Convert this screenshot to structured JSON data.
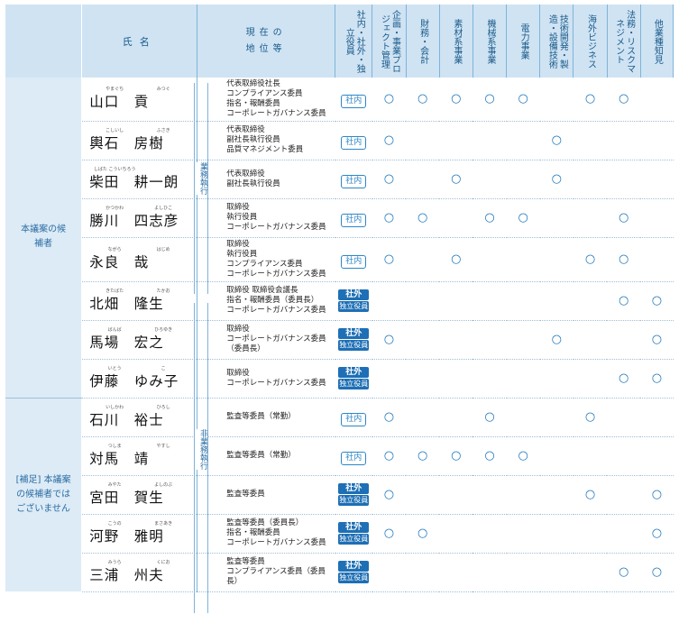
{
  "header": {
    "name": "氏名",
    "position_line1": "現在の",
    "position_line2": "地位等",
    "columns": [
      "社内・社外・独立役員",
      "企画・事業プロジェクト管理",
      "財務・会計",
      "素材系事業",
      "機械系事業",
      "電力事業",
      "技術開発・製造・設備技術",
      "海外ビジネス",
      "法務・リスクマネジメント",
      "他業種知見"
    ]
  },
  "categories": {
    "main": "本議案の候補者",
    "supplement": "[補足] 本議案の候補者ではございません"
  },
  "groups": {
    "executive": "業務執行",
    "non_executive": "非業務執行"
  },
  "badges": {
    "internal": "社内",
    "external": "社外",
    "independent": "独立役員"
  },
  "mark": "○",
  "rows": [
    {
      "ruby1": "やまぐち",
      "ruby2": "みつぐ",
      "name": "山口　貢",
      "positions": [
        "代表取締役社長",
        "コンプライアンス委員",
        "指名・報酬委員",
        "コーポレートガバナンス委員"
      ],
      "type": "internal",
      "marks": [
        1,
        1,
        1,
        1,
        1,
        0,
        1,
        1,
        0
      ]
    },
    {
      "ruby1": "こしいし",
      "ruby2": "ふさき",
      "name": "輿石　房樹",
      "positions": [
        "代表取締役",
        "副社長執行役員",
        "品質マネジメント委員"
      ],
      "type": "internal",
      "marks": [
        1,
        0,
        0,
        0,
        0,
        1,
        0,
        0,
        0
      ]
    },
    {
      "ruby1": "しばた こういちろう",
      "ruby2": "",
      "name": "柴田　耕一朗",
      "positions": [
        "代表取締役",
        "副社長執行役員"
      ],
      "type": "internal",
      "marks": [
        1,
        0,
        1,
        0,
        0,
        1,
        0,
        0,
        0
      ]
    },
    {
      "ruby1": "かつかわ",
      "ruby2": "よしひこ",
      "name": "勝川　四志彦",
      "positions": [
        "取締役",
        "執行役員",
        "コーポレートガバナンス委員"
      ],
      "type": "internal",
      "marks": [
        1,
        1,
        0,
        1,
        1,
        0,
        0,
        1,
        0
      ]
    },
    {
      "ruby1": "ながら",
      "ruby2": "はじめ",
      "name": "永良　哉",
      "positions": [
        "取締役",
        "執行役員",
        "コンプライアンス委員",
        "コーポレートガバナンス委員"
      ],
      "type": "internal",
      "marks": [
        1,
        0,
        1,
        0,
        0,
        0,
        1,
        1,
        0
      ]
    },
    {
      "ruby1": "きたばた",
      "ruby2": "たかお",
      "name": "北畑　隆生",
      "positions": [
        "取締役 取締役会議長",
        "指名・報酬委員（委員長）",
        "コーポレートガバナンス委員"
      ],
      "type": "external",
      "marks": [
        0,
        0,
        0,
        0,
        0,
        0,
        0,
        1,
        1
      ]
    },
    {
      "ruby1": "ばんば",
      "ruby2": "ひろゆき",
      "name": "馬場　宏之",
      "positions": [
        "取締役",
        "コーポレートガバナンス委員（委員長）"
      ],
      "type": "external",
      "marks": [
        1,
        0,
        0,
        0,
        0,
        1,
        0,
        0,
        1
      ]
    },
    {
      "ruby1": "いとう",
      "ruby2": "こ",
      "name": "伊藤　ゆみ子",
      "positions": [
        "取締役",
        "コーポレートガバナンス委員"
      ],
      "type": "external",
      "marks": [
        0,
        0,
        0,
        0,
        0,
        0,
        0,
        1,
        1
      ]
    },
    {
      "ruby1": "いしかわ",
      "ruby2": "ひろし",
      "name": "石川　裕士",
      "positions": [
        "監査等委員（常勤）"
      ],
      "type": "internal",
      "marks": [
        1,
        0,
        0,
        1,
        0,
        0,
        1,
        0,
        0
      ]
    },
    {
      "ruby1": "つしま",
      "ruby2": "やすし",
      "name": "対馬　靖",
      "positions": [
        "監査等委員（常勤）"
      ],
      "type": "internal",
      "marks": [
        1,
        1,
        1,
        1,
        1,
        0,
        0,
        0,
        0
      ]
    },
    {
      "ruby1": "みやた",
      "ruby2": "よしのぶ",
      "name": "宮田　賀生",
      "positions": [
        "監査等委員"
      ],
      "type": "external",
      "marks": [
        1,
        0,
        0,
        0,
        0,
        0,
        1,
        0,
        1
      ]
    },
    {
      "ruby1": "こうの",
      "ruby2": "まさあき",
      "name": "河野　雅明",
      "positions": [
        "監査等委員（委員長）",
        "指名・報酬委員",
        "コーポレートガバナンス委員"
      ],
      "type": "external",
      "marks": [
        1,
        1,
        0,
        0,
        0,
        0,
        0,
        0,
        1
      ]
    },
    {
      "ruby1": "みうら",
      "ruby2": "くにお",
      "name": "三浦　州夫",
      "positions": [
        "監査等委員",
        "コンプライアンス委員（委員長）"
      ],
      "type": "external",
      "marks": [
        0,
        0,
        0,
        0,
        0,
        0,
        0,
        1,
        1
      ]
    }
  ]
}
